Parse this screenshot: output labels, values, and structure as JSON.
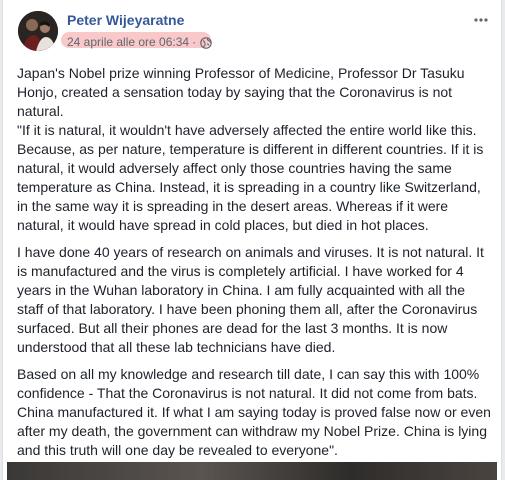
{
  "post": {
    "author": "Peter Wijeyaratne",
    "timestamp": "24 aprile alle ore 06:34",
    "separator": "·",
    "privacy_icon": "globe-icon",
    "more_icon": "more-horizontal-icon",
    "paragraphs": [
      "Japan's Nobel prize winning Professor of Medicine, Professor Dr Tasuku Honjo, created a sensation today by saying that the Coronavirus is not natural.\n\"If it is natural, it wouldn't have adversely affected the entire world like this. Because, as per nature, temperature is different in different countries. If it is natural, it would adversely affect only those countries having the same temperature as China. Instead, it is spreading in a country like Switzerland, in the same way it is spreading in the desert areas. Whereas if it were natural, it would have spread in cold places, but died in hot places.",
      "I have done 40 years of research on animals and viruses. It is not natural. It is manufactured and the virus is completely artificial. I have worked for 4 years in the Wuhan laboratory in China. I am fully acquainted with all the staff of that laboratory. I have been phoning them all, after the Coronavirus surfaced. But all their phones are dead for the last 3 months. It is now understood that all these lab technicians have died.",
      "Based on all my knowledge and research till date, I can say this with 100% confidence - That the Coronavirus is not natural. It did not come from bats. China manufactured it. If what I am saying today is proved false now or even after my death, the government can withdraw my Nobel Prize. China is lying and this truth will one day be revealed to everyone\"."
    ]
  },
  "colors": {
    "author_link": "#365899",
    "meta_text": "#616770",
    "body_text": "#1d2129",
    "highlight": "#f7b5b5"
  }
}
